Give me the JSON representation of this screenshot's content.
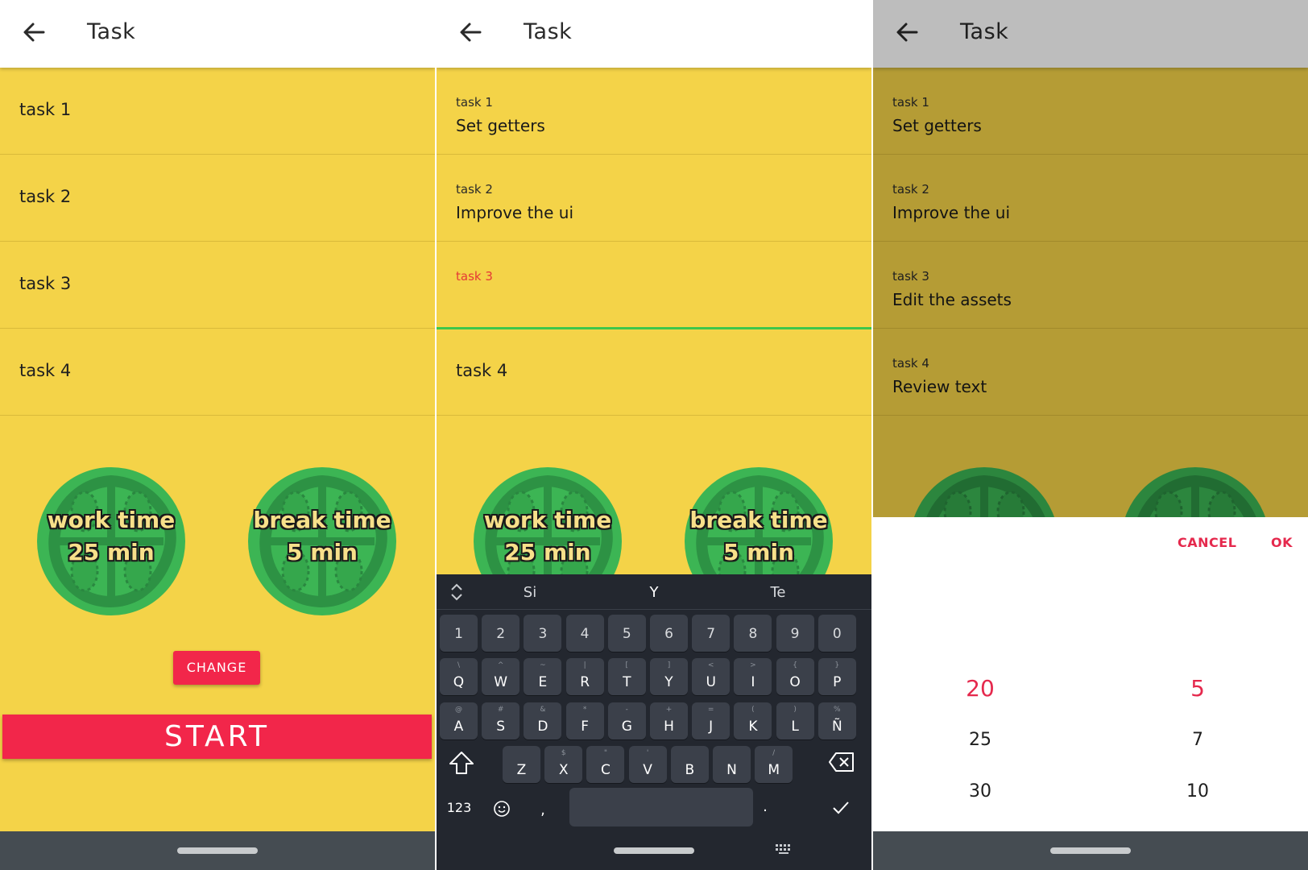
{
  "appbar": {
    "title": "Task"
  },
  "panel1": {
    "rows": [
      "task 1",
      "task 2",
      "task 3",
      "task 4"
    ],
    "work_tomato": {
      "line1": "work time",
      "line2": "25 min"
    },
    "break_tomato": {
      "line1": "break time",
      "line2": "5 min"
    },
    "change_label": "CHANGE",
    "start_label": "START"
  },
  "panel2": {
    "rows": [
      {
        "label": "task 1",
        "value": "Set getters"
      },
      {
        "label": "task 2",
        "value": "Improve the ui"
      },
      {
        "label": "task 3",
        "value": ""
      }
    ],
    "row4": "task 4",
    "suggestions": [
      "Si",
      "Y",
      "Te"
    ],
    "keys_num": [
      "1",
      "2",
      "3",
      "4",
      "5",
      "6",
      "7",
      "8",
      "9",
      "0"
    ],
    "keys_row1": [
      "Q",
      "W",
      "E",
      "R",
      "T",
      "Y",
      "U",
      "I",
      "O",
      "P"
    ],
    "hints_row1": [
      "\\",
      "^",
      "~",
      "|",
      "[",
      "]",
      "<",
      ">",
      "{",
      "}"
    ],
    "keys_row2": [
      "A",
      "S",
      "D",
      "F",
      "G",
      "H",
      "J",
      "K",
      "L",
      "Ñ"
    ],
    "hints_row2": [
      "@",
      "#",
      "&",
      "*",
      "-",
      "+",
      "=",
      "(",
      ")",
      "%"
    ],
    "keys_row3": [
      "Z",
      "X",
      "C",
      "V",
      "B",
      "N",
      "M"
    ],
    "hints_row3": [
      "",
      "$",
      "\"",
      "'",
      "",
      "",
      "/"
    ],
    "mode_key": "123",
    "comma_key": ",",
    "period_key": "."
  },
  "panel3": {
    "rows": [
      {
        "label": "task 1",
        "value": "Set getters"
      },
      {
        "label": "task 2",
        "value": "Improve the ui"
      },
      {
        "label": "task 3",
        "value": "Edit the assets"
      },
      {
        "label": "task 4",
        "value": "Review text"
      }
    ],
    "cancel_label": "CANCEL",
    "ok_label": "OK",
    "left_picker": [
      "20",
      "25",
      "30"
    ],
    "right_picker": [
      "5",
      "7",
      "10"
    ],
    "left_selected": "20",
    "right_selected": "5"
  },
  "colors": {
    "background": "#f4d348",
    "accent": "#f2264a",
    "tomato": "#3cb554",
    "input_focus": "#3ec64b",
    "keyboard": "#23272f"
  }
}
